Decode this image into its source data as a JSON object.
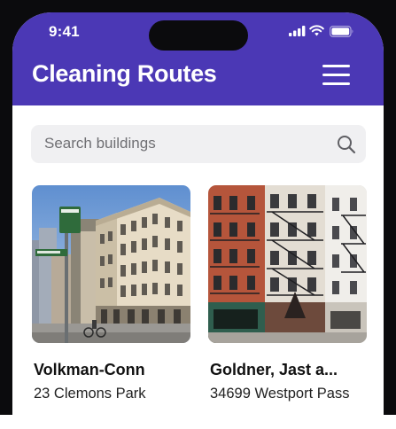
{
  "status_bar": {
    "time": "9:41",
    "icons": [
      "cellular-signal-icon",
      "wifi-icon",
      "battery-icon"
    ]
  },
  "header": {
    "title": "Cleaning Routes",
    "menu_icon": "hamburger-menu-icon",
    "background_color": "#4b38b5"
  },
  "search": {
    "placeholder": "Search buildings",
    "icon": "search-icon"
  },
  "buildings": [
    {
      "name": "Volkman-Conn",
      "address": "23 Clemons Park",
      "image": "cast-iron corner building with street sign"
    },
    {
      "name": "Goldner, Jast a...",
      "address": "34699 Westport Pass",
      "image": "brick tenement rowhouses with fire escapes"
    }
  ]
}
